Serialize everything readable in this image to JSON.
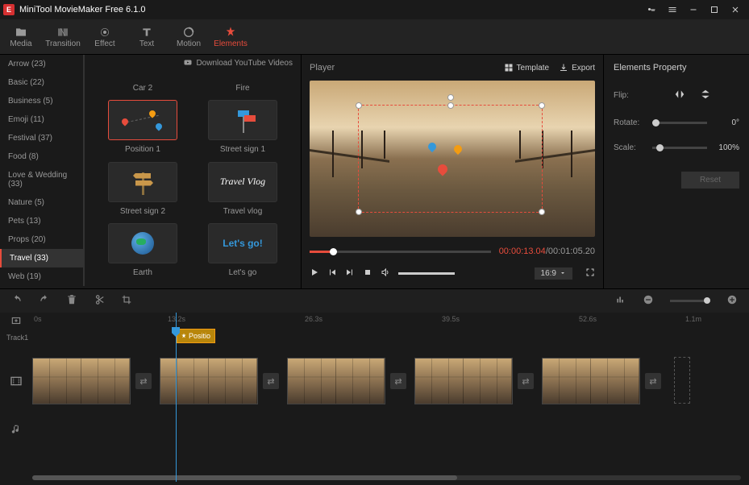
{
  "titlebar": {
    "title": "MiniTool MovieMaker Free 6.1.0"
  },
  "toolbar": {
    "items": [
      {
        "label": "Media"
      },
      {
        "label": "Transition"
      },
      {
        "label": "Effect"
      },
      {
        "label": "Text"
      },
      {
        "label": "Motion"
      },
      {
        "label": "Elements"
      }
    ]
  },
  "download_link": "Download YouTube Videos",
  "categories": [
    {
      "label": "Arrow (23)"
    },
    {
      "label": "Basic (22)"
    },
    {
      "label": "Business (5)"
    },
    {
      "label": "Emoji (11)"
    },
    {
      "label": "Festival (37)"
    },
    {
      "label": "Food (8)"
    },
    {
      "label": "Love & Wedding (33)"
    },
    {
      "label": "Nature (5)"
    },
    {
      "label": "Pets (13)"
    },
    {
      "label": "Props (20)"
    },
    {
      "label": "Travel (33)"
    },
    {
      "label": "Web (19)"
    }
  ],
  "library": [
    {
      "label": "Car 2"
    },
    {
      "label": "Fire"
    },
    {
      "label": "Position 1"
    },
    {
      "label": "Street sign 1"
    },
    {
      "label": "Street sign 2"
    },
    {
      "label": "Travel vlog"
    },
    {
      "label": "Earth"
    },
    {
      "label": "Let's go"
    }
  ],
  "player": {
    "title": "Player",
    "template": "Template",
    "export": "Export",
    "time_current": "00:00:13.04",
    "time_separator": " / ",
    "time_total": "00:01:05.20",
    "aspect": "16:9"
  },
  "props": {
    "title": "Elements Property",
    "flip_label": "Flip:",
    "rotate_label": "Rotate:",
    "rotate_value": "0°",
    "scale_label": "Scale:",
    "scale_value": "100%",
    "reset": "Reset"
  },
  "ruler": {
    "t0": "0s",
    "t1": "13.2s",
    "t2": "26.3s",
    "t3": "39.5s",
    "t4": "52.6s",
    "t5": "1.1m"
  },
  "track": {
    "label": "Track1",
    "element_clip": "Positio"
  }
}
